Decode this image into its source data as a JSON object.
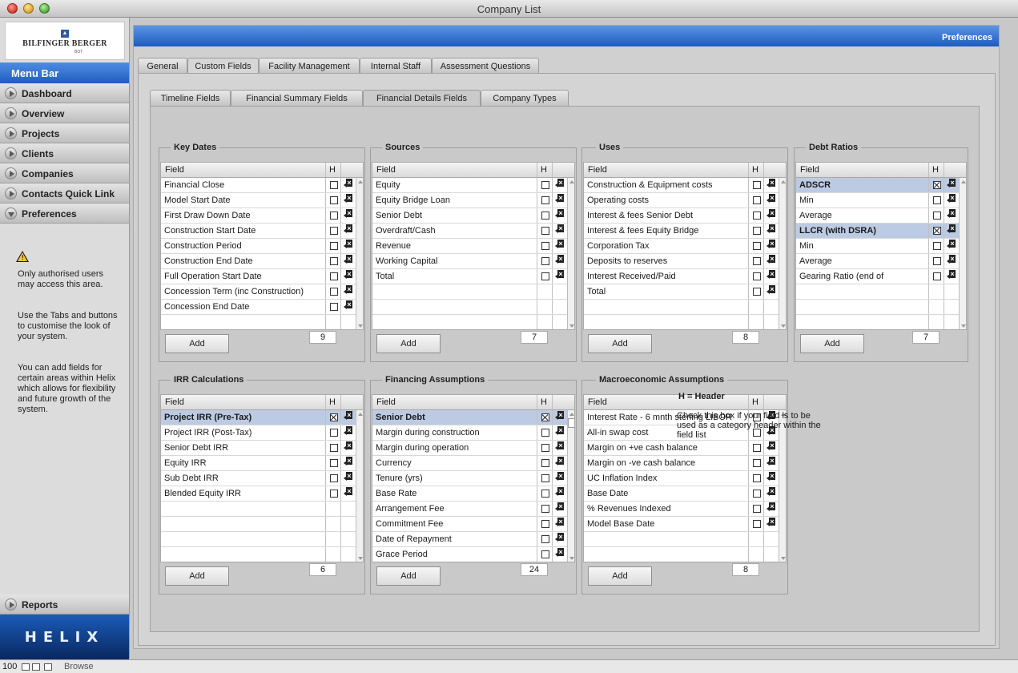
{
  "window": {
    "title": "Company List"
  },
  "sidebar": {
    "logo_name": "Bilfinger Berger",
    "logo_sub": "BOT",
    "menu_bar_label": "Menu Bar",
    "items": [
      {
        "label": "Dashboard",
        "expanded": false
      },
      {
        "label": "Overview",
        "expanded": false
      },
      {
        "label": "Projects",
        "expanded": false
      },
      {
        "label": "Clients",
        "expanded": false
      },
      {
        "label": "Companies",
        "expanded": false
      },
      {
        "label": "Contacts Quick Link",
        "expanded": false
      },
      {
        "label": "Preferences",
        "expanded": true
      }
    ],
    "warning_icon": "warning-icon",
    "help_1": "Only authorised users may access this area.",
    "help_2": "Use the Tabs and buttons to customise the look of your system.",
    "help_3": "You can add fields for certain areas within Helix which allows for flexibility and future growth of the system.",
    "reports_label": "Reports",
    "brand": "HELIX"
  },
  "statusbar": {
    "zoom": "100",
    "mode": "Browse"
  },
  "header": {
    "title": "Preferences"
  },
  "tabs_primary": [
    "General",
    "Custom Fields",
    "Facility Management",
    "Internal Staff",
    "Assessment Questions"
  ],
  "tabs_secondary": [
    "Timeline Fields",
    "Financial Summary Fields",
    "Financial Details Fields",
    "Company Types"
  ],
  "table_header": {
    "field": "Field",
    "h": "H"
  },
  "add_label": "Add",
  "groups": {
    "key_dates": {
      "title": "Key Dates",
      "count": "9",
      "rows": [
        {
          "name": "Financial Close",
          "header": false
        },
        {
          "name": "Model Start Date",
          "header": false
        },
        {
          "name": "First Draw Down Date",
          "header": false
        },
        {
          "name": "Construction Start Date",
          "header": false
        },
        {
          "name": "Construction Period",
          "header": false
        },
        {
          "name": "Construction End Date",
          "header": false
        },
        {
          "name": "Full Operation Start Date",
          "header": false
        },
        {
          "name": "Concession Term (inc Construction)",
          "header": false
        },
        {
          "name": "Concession End Date",
          "header": false
        }
      ]
    },
    "sources": {
      "title": "Sources",
      "count": "7",
      "rows": [
        {
          "name": "Equity",
          "header": false
        },
        {
          "name": "Equity Bridge Loan",
          "header": false
        },
        {
          "name": "Senior Debt",
          "header": false
        },
        {
          "name": "Overdraft/Cash",
          "header": false
        },
        {
          "name": "Revenue",
          "header": false
        },
        {
          "name": "Working Capital",
          "header": false
        },
        {
          "name": "Total",
          "header": false
        }
      ]
    },
    "uses": {
      "title": "Uses",
      "count": "8",
      "rows": [
        {
          "name": "Construction & Equipment costs",
          "header": false
        },
        {
          "name": "Operating costs",
          "header": false
        },
        {
          "name": "Interest & fees Senior Debt",
          "header": false
        },
        {
          "name": "Interest & fees Equity Bridge",
          "header": false
        },
        {
          "name": "Corporation Tax",
          "header": false
        },
        {
          "name": "Deposits to reserves",
          "header": false
        },
        {
          "name": "Interest Received/Paid",
          "header": false
        },
        {
          "name": "Total",
          "header": false
        }
      ]
    },
    "debt_ratios": {
      "title": "Debt Ratios",
      "count": "7",
      "rows": [
        {
          "name": "ADSCR",
          "header": true
        },
        {
          "name": "Min",
          "header": false
        },
        {
          "name": "Average",
          "header": false
        },
        {
          "name": "LLCR (with DSRA)",
          "header": true
        },
        {
          "name": "Min",
          "header": false
        },
        {
          "name": "Average",
          "header": false
        },
        {
          "name": "Gearing Ratio (end of",
          "header": false
        }
      ]
    },
    "irr": {
      "title": "IRR Calculations",
      "count": "6",
      "rows": [
        {
          "name": "Project IRR (Pre-Tax)",
          "header": true
        },
        {
          "name": "Project IRR (Post-Tax)",
          "header": false
        },
        {
          "name": "Senior Debt IRR",
          "header": false
        },
        {
          "name": "Equity IRR",
          "header": false
        },
        {
          "name": "Sub Debt IRR",
          "header": false
        },
        {
          "name": "Blended Equity IRR",
          "header": false
        }
      ]
    },
    "financing": {
      "title": "Financing Assumptions",
      "count": "24",
      "rows": [
        {
          "name": "Senior Debt",
          "header": true
        },
        {
          "name": "Margin during construction",
          "header": false
        },
        {
          "name": "Margin during operation",
          "header": false
        },
        {
          "name": "Currency",
          "header": false
        },
        {
          "name": "Tenure (yrs)",
          "header": false
        },
        {
          "name": "Base Rate",
          "header": false
        },
        {
          "name": "Arrangement Fee",
          "header": false
        },
        {
          "name": "Commitment Fee",
          "header": false
        },
        {
          "name": "Date of Repayment",
          "header": false
        },
        {
          "name": "Grace Period",
          "header": false
        }
      ]
    },
    "macro": {
      "title": "Macroeconomic Assumptions",
      "count": "8",
      "rows": [
        {
          "name": "Interest Rate - 6 mnth sterling LIBOR",
          "header": false
        },
        {
          "name": "All-in swap cost",
          "header": false
        },
        {
          "name": "Margin on +ve cash balance",
          "header": false
        },
        {
          "name": "Margin on -ve cash balance",
          "header": false
        },
        {
          "name": "UC Inflation Index",
          "header": false
        },
        {
          "name": "Base Date",
          "header": false
        },
        {
          "name": "% Revenues Indexed",
          "header": false
        },
        {
          "name": "Model Base Date",
          "header": false
        }
      ]
    }
  },
  "note": {
    "title": "H = Header",
    "text": "Check this box if your field is to be used as a category header within the field list"
  },
  "colors": {
    "accent": "#1f5dbf",
    "header_row": "#bccbe3"
  }
}
